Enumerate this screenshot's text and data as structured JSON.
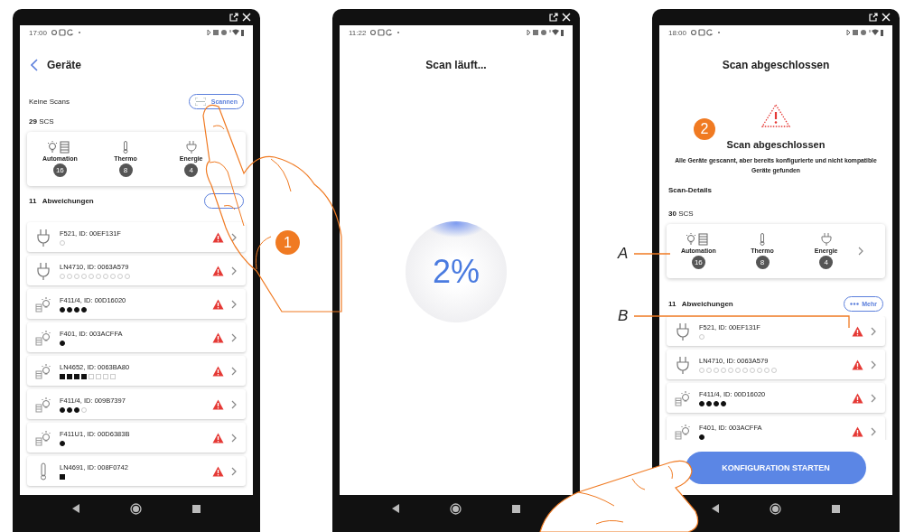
{
  "screens": [
    {
      "kind": "device_list",
      "status_bar": {
        "time": "17:00"
      },
      "title": "Geräte",
      "scan_status": "Keine Scans",
      "scan_button": "Scannen",
      "summary": {
        "count": "29",
        "unit": "SCS"
      },
      "categories": [
        {
          "kind": "automation",
          "label": "Automation",
          "count": "16"
        },
        {
          "kind": "thermo",
          "label": "Thermo",
          "count": "8"
        },
        {
          "kind": "energy",
          "label": "Energie",
          "count": "4"
        }
      ],
      "deviations": {
        "count": "11",
        "label": "Abweichungen"
      },
      "devices": [
        {
          "kind": "plug",
          "name": "F521, ID: 00EF131F",
          "indicators": {
            "kind": "circle",
            "states": [
              false
            ]
          },
          "warning": true
        },
        {
          "kind": "plug",
          "name": "LN4710, ID: 0063A579",
          "indicators": {
            "kind": "circle",
            "states": [
              false,
              false,
              false,
              false,
              false,
              false,
              false,
              false,
              false,
              false
            ]
          },
          "warning": true
        },
        {
          "kind": "light",
          "name": "F411/4, ID: 00D16020",
          "indicators": {
            "kind": "circle",
            "states": [
              true,
              true,
              true,
              true
            ]
          },
          "warning": true
        },
        {
          "kind": "light",
          "name": "F401, ID: 003ACFFA",
          "indicators": {
            "kind": "circle",
            "states": [
              true
            ]
          },
          "warning": true
        },
        {
          "kind": "light",
          "name": "LN4652, ID: 0063BA80",
          "indicators": {
            "kind": "square",
            "states": [
              true,
              true,
              true,
              true,
              false,
              false,
              false,
              false
            ]
          },
          "warning": true
        },
        {
          "kind": "light",
          "name": "F411/4, ID: 009B7397",
          "indicators": {
            "kind": "circle",
            "states": [
              true,
              true,
              true,
              false
            ]
          },
          "warning": true
        },
        {
          "kind": "light",
          "name": "F411U1, ID: 00D6383B",
          "indicators": {
            "kind": "circle",
            "states": [
              true
            ]
          },
          "warning": true
        },
        {
          "kind": "thermo",
          "name": "LN4691, ID: 008F0742",
          "indicators": {
            "kind": "square",
            "states": [
              true
            ]
          },
          "warning": true
        }
      ]
    },
    {
      "kind": "scan_progress",
      "status_bar": {
        "time": "11:22"
      },
      "title": "Scan läuft...",
      "progress": "2%"
    },
    {
      "kind": "scan_result",
      "status_bar": {
        "time": "18:00"
      },
      "title": "Scan abgeschlossen",
      "heading": "Scan abgeschlossen",
      "message": "Alle Geräte gescannt, aber bereits konfigurierte und nicht kompatible Geräte gefunden",
      "details_label": "Scan-Details",
      "summary": {
        "count": "30",
        "unit": "SCS"
      },
      "categories": [
        {
          "kind": "automation",
          "label": "Automation",
          "count": "16"
        },
        {
          "kind": "thermo",
          "label": "Thermo",
          "count": "8"
        },
        {
          "kind": "energy",
          "label": "Energie",
          "count": "4"
        }
      ],
      "deviations": {
        "count": "11",
        "label": "Abweichungen",
        "more_button": "Mehr"
      },
      "devices": [
        {
          "kind": "plug",
          "name": "F521, ID: 00EF131F",
          "indicators": {
            "kind": "circle",
            "states": [
              false
            ]
          },
          "warning": true
        },
        {
          "kind": "plug",
          "name": "LN4710, ID: 0063A579",
          "indicators": {
            "kind": "circle",
            "states": [
              false,
              false,
              false,
              false,
              false,
              false,
              false,
              false,
              false,
              false,
              false
            ]
          },
          "warning": true
        },
        {
          "kind": "light",
          "name": "F411/4, ID: 00D16020",
          "indicators": {
            "kind": "circle",
            "states": [
              true,
              true,
              true,
              true
            ]
          },
          "warning": true
        },
        {
          "kind": "light",
          "name": "F401, ID: 003ACFFA",
          "indicators": {
            "kind": "circle",
            "states": [
              true
            ]
          },
          "warning": true
        }
      ],
      "action_button": "KONFIGURATION STARTEN"
    }
  ],
  "callouts": [
    {
      "label": "1"
    },
    {
      "label": "2"
    }
  ],
  "annotations": [
    {
      "label": "A"
    },
    {
      "label": "B"
    }
  ]
}
